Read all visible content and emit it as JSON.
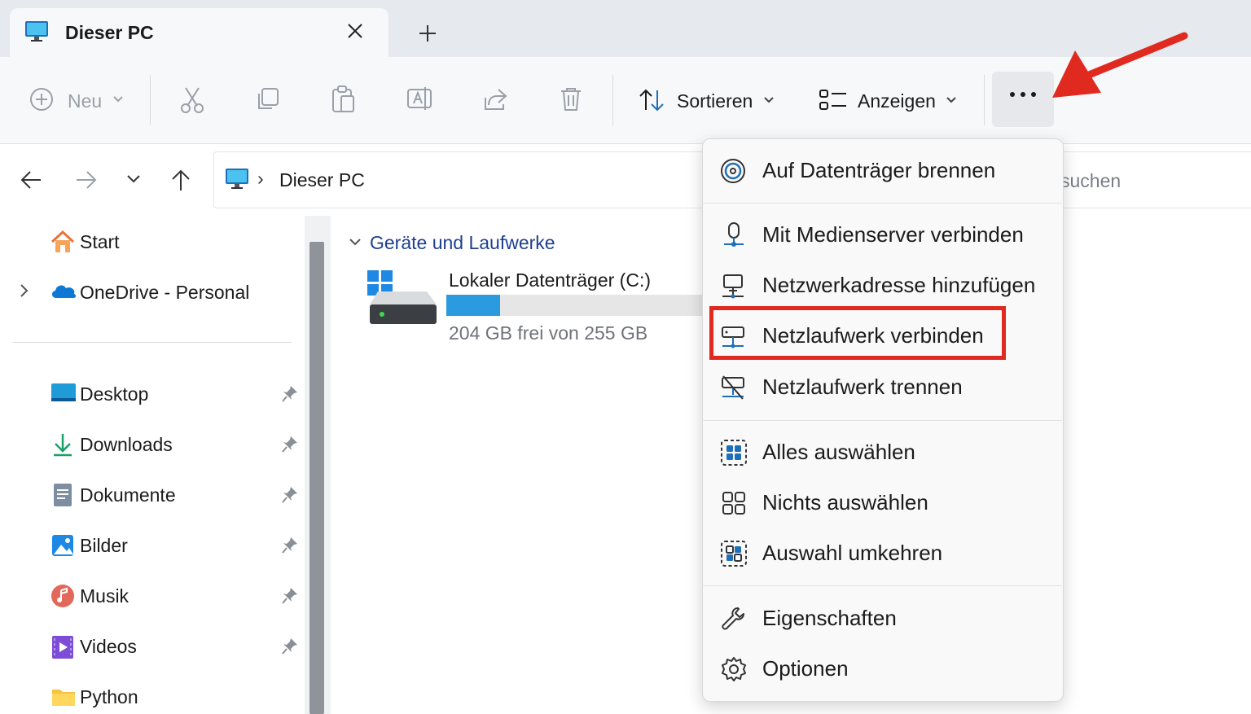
{
  "tab": {
    "title": "Dieser PC",
    "close": "×",
    "new_tab": "+"
  },
  "toolbar": {
    "new_label": "Neu",
    "sort_label": "Sortieren",
    "view_label": "Anzeigen",
    "more_label": "•••"
  },
  "address": {
    "crumb_sep": "›",
    "path": "Dieser PC",
    "search_placeholder": "suchen"
  },
  "sidebar": {
    "top": [
      {
        "label": "Start"
      },
      {
        "label": "OneDrive - Personal"
      }
    ],
    "quick": [
      {
        "label": "Desktop"
      },
      {
        "label": "Downloads"
      },
      {
        "label": "Dokumente"
      },
      {
        "label": "Bilder"
      },
      {
        "label": "Musik"
      },
      {
        "label": "Videos"
      },
      {
        "label": "Python"
      }
    ]
  },
  "content": {
    "group_title": "Geräte und Laufwerke",
    "drive": {
      "name": "Lokaler Datenträger (C:)",
      "free_text": "204 GB frei von 255 GB",
      "used_fraction": 0.2
    }
  },
  "menu": {
    "items": [
      {
        "label": "Auf Datenträger brennen",
        "icon": "disc-burn-icon"
      },
      {
        "label": "Mit Medienserver verbinden",
        "icon": "media-server-icon"
      },
      {
        "label": "Netzwerkadresse hinzufügen",
        "icon": "network-location-icon"
      },
      {
        "label": "Netzlaufwerk verbinden",
        "icon": "map-network-drive-icon"
      },
      {
        "label": "Netzlaufwerk trennen",
        "icon": "disconnect-network-drive-icon"
      },
      {
        "label": "Alles auswählen",
        "icon": "select-all-icon"
      },
      {
        "label": "Nichts auswählen",
        "icon": "select-none-icon"
      },
      {
        "label": "Auswahl umkehren",
        "icon": "invert-selection-icon"
      },
      {
        "label": "Eigenschaften",
        "icon": "wrench-icon"
      },
      {
        "label": "Optionen",
        "icon": "gear-icon"
      }
    ]
  },
  "colors": {
    "annotation_red": "#e02a1f",
    "accent_blue": "#2b9be0",
    "group_blue": "#1e3f8f"
  }
}
